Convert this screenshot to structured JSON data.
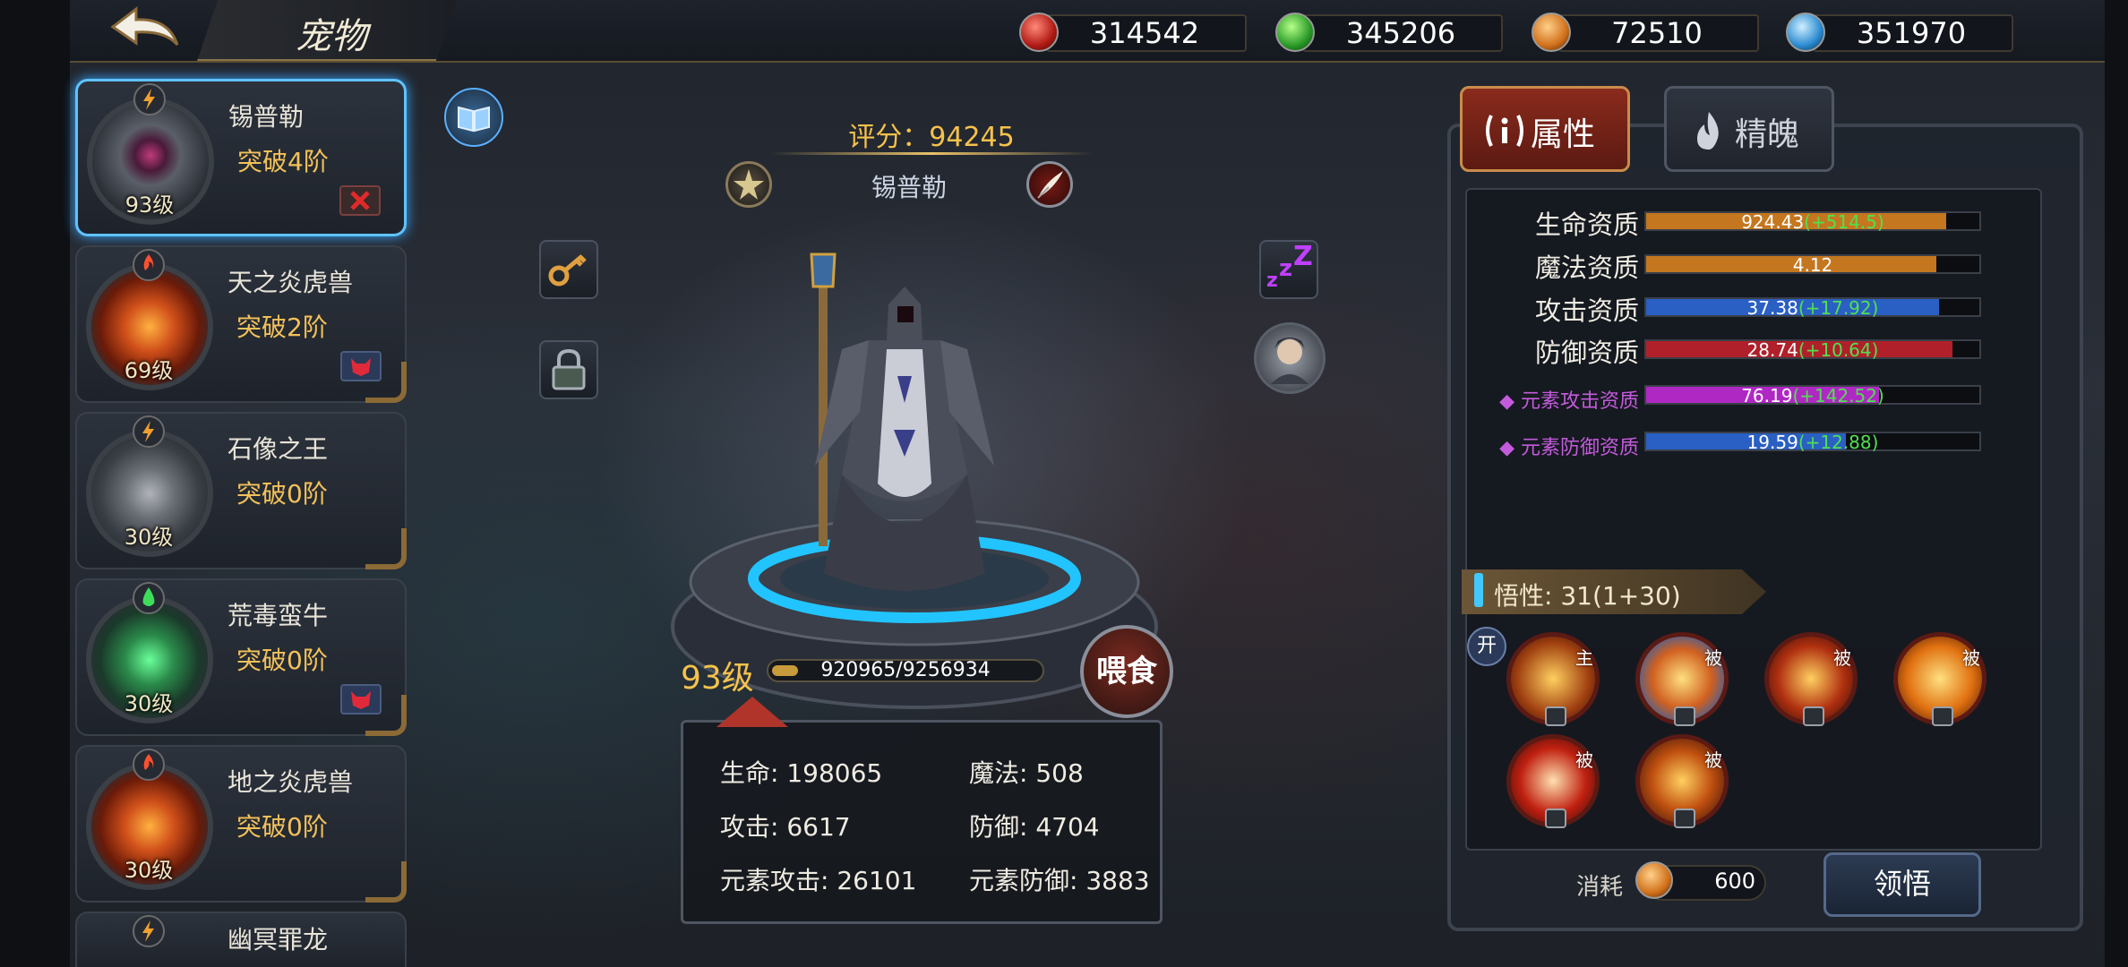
{
  "header": {
    "title": "宠物",
    "resources": [
      {
        "icon": "red-gem-icon",
        "value": "314542",
        "color": "#d9342b"
      },
      {
        "icon": "green-gem-icon",
        "value": "345206",
        "color": "#3fbf4a"
      },
      {
        "icon": "orange-gem-icon",
        "value": "72510",
        "color": "#e08a2a"
      },
      {
        "icon": "blue-gem-icon",
        "value": "351970",
        "color": "#3aa6e0"
      }
    ]
  },
  "pet_list": [
    {
      "name": "锡普勒",
      "stage": "突破4阶",
      "level": "93级",
      "element": "lightning",
      "selected": true
    },
    {
      "name": "天之炎虎兽",
      "stage": "突破2阶",
      "level": "69级",
      "element": "fire"
    },
    {
      "name": "石像之王",
      "stage": "突破0阶",
      "level": "30级",
      "element": "lightning"
    },
    {
      "name": "荒毒蛮牛",
      "stage": "突破0阶",
      "level": "30级",
      "element": "poison"
    },
    {
      "name": "地之炎虎兽",
      "stage": "突破0阶",
      "level": "30级",
      "element": "fire"
    },
    {
      "name": "幽冥罪龙",
      "element": "lightning"
    }
  ],
  "center": {
    "score": "评分：94245",
    "pet_name": "锡普勒",
    "level": "93级",
    "exp_text": "920965/9256934",
    "exp_fraction": 0.0995,
    "feed_label": "喂食",
    "stats": {
      "hp": "生命: 198065",
      "mp": "魔法: 508",
      "atk": "攻击: 6617",
      "def": "防御: 4704",
      "elem_atk": "元素攻击: 26101",
      "elem_def": "元素防御: 3883"
    }
  },
  "right_panel": {
    "tabs": [
      "属性",
      "精魄"
    ],
    "active_tab": "属性",
    "attributes": [
      {
        "label": "生命资质",
        "base": "924.43",
        "bonus": "(+514.5)",
        "fill": 0.9,
        "color": "#c4771f"
      },
      {
        "label": "魔法资质",
        "base": "4.12",
        "bonus": "",
        "fill": 0.87,
        "color": "#c4771f"
      },
      {
        "label": "攻击资质",
        "base": "37.38",
        "bonus": "(+17.92)",
        "fill": 0.88,
        "color": "#2a5fc4"
      },
      {
        "label": "防御资质",
        "base": "28.74",
        "bonus": "(+10.64)",
        "fill": 0.92,
        "color": "#b0202a"
      },
      {
        "label": "元素攻击资质",
        "base": "76.19",
        "bonus": "(+142.52)",
        "fill": 0.7,
        "color": "#b028c4"
      },
      {
        "label": "元素防御资质",
        "base": "19.59",
        "bonus": "(+12.88)",
        "fill": 0.6,
        "color": "#2a5fc4"
      }
    ],
    "comprehension": "悟性: 31(1+30)",
    "open_label": "开",
    "skills": [
      {
        "tag": "主"
      },
      {
        "tag": "被"
      },
      {
        "tag": "被"
      },
      {
        "tag": "被"
      },
      {
        "tag": "被"
      },
      {
        "tag": "被"
      }
    ],
    "cost_label": "消耗",
    "cost_value": "600",
    "comprehend_label": "领悟"
  }
}
